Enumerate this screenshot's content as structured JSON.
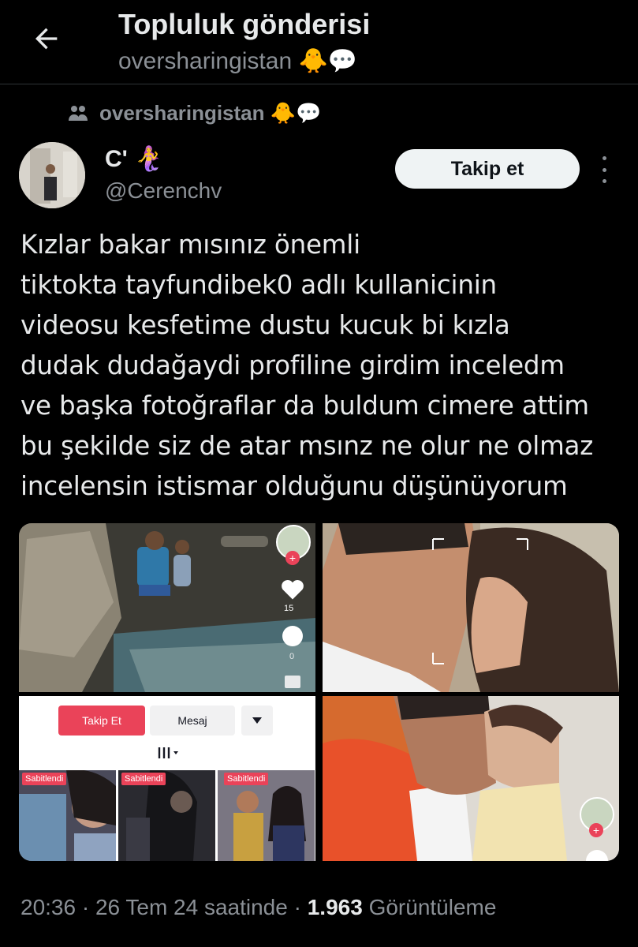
{
  "header": {
    "title": "Topluluk gönderisi",
    "subtitle": "oversharingistan 🐥💬"
  },
  "community": {
    "name": "oversharingistan 🐥💬"
  },
  "author": {
    "name": "C' 🧜‍♀️",
    "handle": "@Cerenchv",
    "follow_label": "Takip et"
  },
  "tweet": {
    "lines": [
      "Kızlar bakar mısınız önemli",
      "tiktokta tayfundibek0 adlı kullanicinin",
      "videosu kesfetime dustu kucuk bi kızla",
      "dudak dudağaydi profiline girdim inceledm",
      "ve başka fotoğraflar da buldum cimere attim",
      "bu şekilde siz de atar msınz ne olur ne olmaz",
      "incelensin istismar olduğunu düşünüyorum"
    ]
  },
  "media": {
    "tiktok_like_count": "15",
    "tiktok_comment_count": "0",
    "profile_follow_label": "Takip Et",
    "profile_message_label": "Mesaj",
    "pinned_labels": [
      "Sabitlendi",
      "Sabitlendi",
      "Sabitlendi"
    ]
  },
  "meta": {
    "time": "20:36 · 26 Tem 24 saatinde · ",
    "views_count": "1.963",
    "views_label": " Görüntüleme"
  },
  "colors": {
    "background": "#000000",
    "text_primary": "#e7e9ea",
    "text_secondary": "#8b9096",
    "tiktok_red": "#ea4359"
  },
  "icons": {
    "back": "arrow-left-icon",
    "community": "people-icon",
    "more": "more-vertical-icon"
  }
}
